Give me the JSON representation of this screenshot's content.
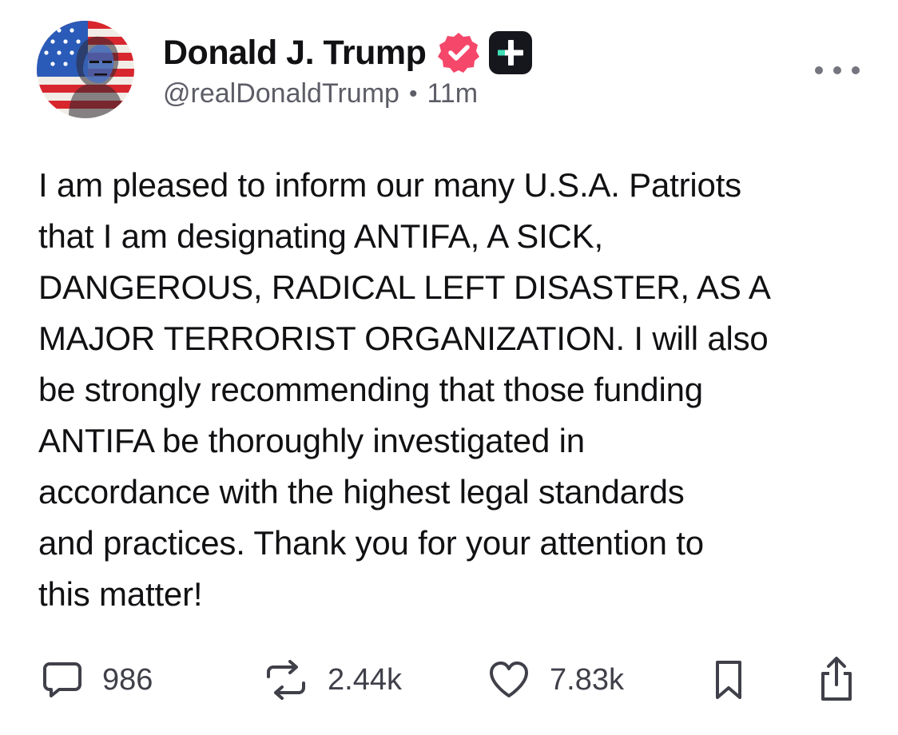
{
  "post": {
    "author": {
      "display_name": "Donald J. Trump",
      "handle": "@realDonaldTrump",
      "verified_icon": "verified-badge-icon",
      "badge_icon": "truth-plus-icon",
      "avatar": "avatar-flag-portrait"
    },
    "timestamp": "11m",
    "meta_separator": "•",
    "more_icon": "more-horizontal-icon",
    "text": "I am pleased to inform our many U.S.A. Patriots\nthat I am designating ANTIFA, A SICK,\nDANGEROUS, RADICAL LEFT DISASTER, AS A\nMAJOR TERRORIST ORGANIZATION. I will also\nbe strongly recommending that those funding\nANTIFA be thoroughly investigated in\naccordance with the highest legal standards\nand practices. Thank you for your attention to\nthis matter!",
    "actions": {
      "replies": {
        "icon": "comment-icon",
        "count": "986"
      },
      "retruths": {
        "icon": "retruth-icon",
        "count": "2.44k"
      },
      "likes": {
        "icon": "heart-icon",
        "count": "7.83k"
      },
      "bookmark": {
        "icon": "bookmark-icon"
      },
      "share": {
        "icon": "share-icon"
      }
    }
  },
  "colors": {
    "verified_badge": "#f5476a",
    "plus_badge_bg": "#16161d",
    "plus_badge_accent": "#3ee0b5",
    "text_primary": "#111114",
    "text_secondary": "#5c5d66",
    "icon": "#3f4049"
  }
}
